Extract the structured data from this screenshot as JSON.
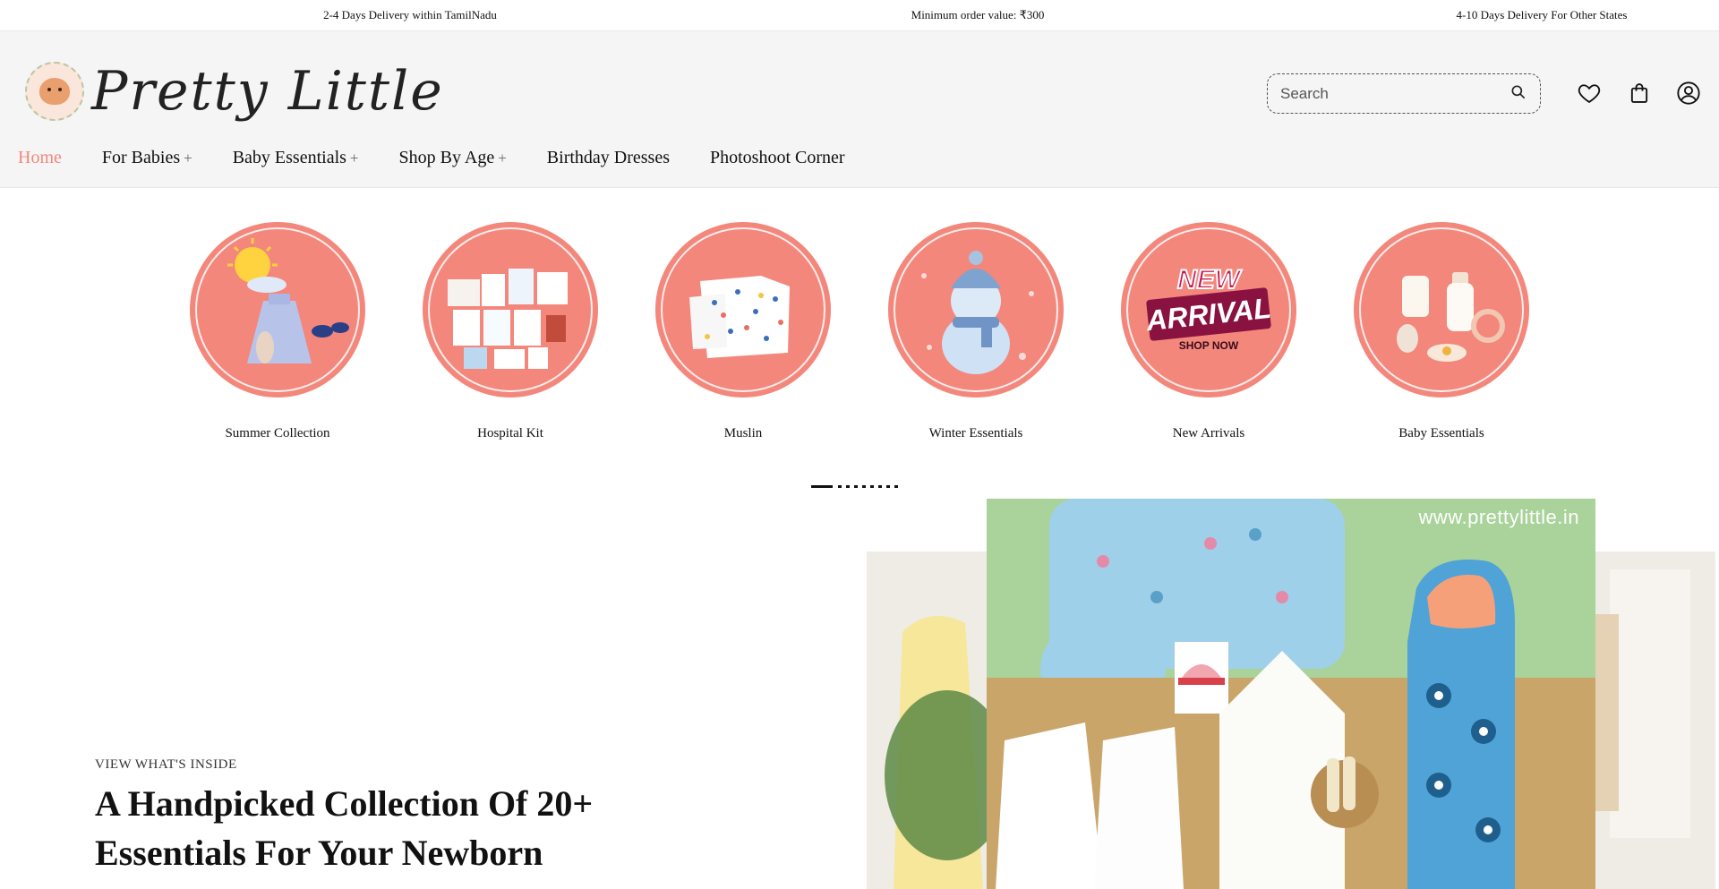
{
  "announcements": [
    "2-4 Days Delivery within TamilNadu",
    "Minimum order value: ₹300",
    "4-10 Days Delivery For Other States"
  ],
  "brand": {
    "name": "Pretty Little"
  },
  "search": {
    "placeholder": "Search"
  },
  "nav": {
    "items": [
      {
        "label": "Home",
        "has_submenu": false
      },
      {
        "label": "For Babies",
        "has_submenu": true
      },
      {
        "label": "Baby Essentials",
        "has_submenu": true
      },
      {
        "label": "Shop By Age",
        "has_submenu": true
      },
      {
        "label": "Birthday Dresses",
        "has_submenu": false
      },
      {
        "label": "Photoshoot Corner",
        "has_submenu": false
      }
    ],
    "submenu_glyph": "+"
  },
  "categories": [
    {
      "label": "Summer Collection"
    },
    {
      "label": "Hospital Kit"
    },
    {
      "label": "Muslin"
    },
    {
      "label": "Winter Essentials"
    },
    {
      "label": "New Arrivals",
      "badge_line1": "NEW",
      "badge_line2": "ARRIVAL",
      "badge_line3": "SHOP NOW"
    },
    {
      "label": "Baby Essentials"
    }
  ],
  "slider": {
    "total_pages": 9,
    "active_page": 1
  },
  "hero": {
    "kicker": "VIEW WHAT'S INSIDE",
    "title": "A Handpicked Collection Of 20+ Essentials For Your Newborn",
    "watermark": "www.prettylittle.in"
  },
  "icons": {
    "search": "search-icon",
    "wishlist": "heart-icon",
    "cart": "shopping-bag-icon",
    "account": "user-circle-icon"
  },
  "colors": {
    "accent": "#f08a7e",
    "circle_bg": "#f3877c",
    "header_bg": "#f5f5f5"
  }
}
